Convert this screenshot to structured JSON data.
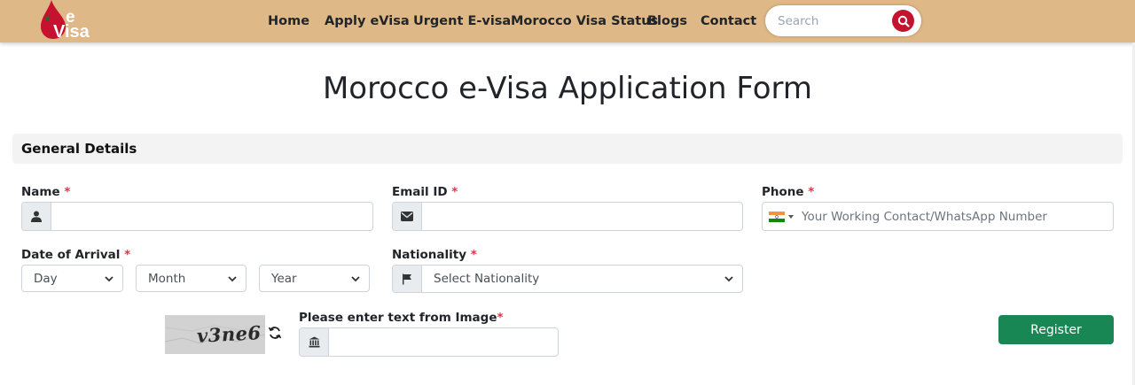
{
  "nav": {
    "logo": {
      "text_e": "e",
      "text_visa": "Visa",
      "brand_color": "#c4122f"
    },
    "links": [
      "Home",
      "Apply eVisa",
      "Urgent E-visa",
      "Morocco Visa Status",
      "Blogs",
      "Contact"
    ],
    "search_placeholder": "Search",
    "background": "#dfb887"
  },
  "page": {
    "title": "Morocco e-Visa Application Form",
    "section_title": "General Details"
  },
  "form": {
    "name_label": "Name",
    "email_label": "Email ID",
    "phone_label": "Phone",
    "phone_placeholder": "Your Working Contact/WhatsApp Number",
    "arrival_label": "Date of Arrival",
    "day_option": "Day",
    "month_option": "Month",
    "year_option": "Year",
    "nationality_label": "Nationality",
    "nationality_option": "Select Nationality",
    "captcha_label": "Please enter text from Image",
    "captcha_text": "v3ne6",
    "required_mark": "*",
    "register_label": "Register"
  },
  "icons": {
    "name": "user-icon",
    "email": "envelope-icon",
    "phone_flag": "india-flag-icon",
    "nationality": "flag-icon",
    "captcha": "building-icon",
    "refresh": "refresh-icon",
    "search": "search-icon"
  },
  "colors": {
    "accent_red": "#c4122f",
    "required": "#dc3545",
    "register_button": "#198754"
  }
}
